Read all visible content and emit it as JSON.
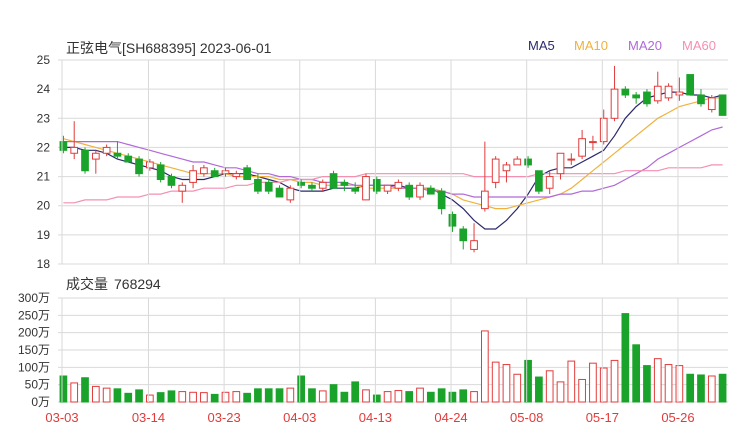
{
  "header": {
    "title": "正弦电气[SH688395] 2023-06-01"
  },
  "legend": [
    {
      "label": "MA5",
      "color": "#2a2a6e"
    },
    {
      "label": "MA10",
      "color": "#f0b23c"
    },
    {
      "label": "MA20",
      "color": "#b169d8"
    },
    {
      "label": "MA60",
      "color": "#f58fb0"
    }
  ],
  "volume": {
    "label": "成交量",
    "value": "768294"
  },
  "colors": {
    "up": "#e23b3b",
    "down": "#1aa32a",
    "grid": "#d9d9d9",
    "axis_text": "#e23b3b"
  },
  "chart_data": [
    {
      "type": "candlestick",
      "title": "正弦电气[SH688395] 2023-06-01",
      "ylim": [
        18,
        25
      ],
      "yticks": [
        "25",
        "24",
        "23",
        "22",
        "21",
        "20",
        "19",
        "18"
      ],
      "x_tick_labels": [
        "03-03",
        "03-14",
        "03-23",
        "04-03",
        "04-13",
        "04-24",
        "05-08",
        "05-17",
        "05-26"
      ],
      "x_tick_index": [
        0,
        8,
        15,
        22,
        29,
        36,
        43,
        50,
        57
      ],
      "ohlc": [
        [
          22.2,
          22.4,
          21.8,
          21.9
        ],
        [
          21.8,
          22.9,
          21.6,
          22.0
        ],
        [
          21.9,
          22.0,
          21.1,
          21.2
        ],
        [
          21.6,
          21.9,
          21.1,
          21.8
        ],
        [
          21.8,
          22.1,
          21.7,
          22.0
        ],
        [
          21.8,
          22.2,
          21.6,
          21.7
        ],
        [
          21.7,
          21.8,
          21.5,
          21.5
        ],
        [
          21.6,
          21.7,
          21.0,
          21.1
        ],
        [
          21.3,
          21.6,
          21.2,
          21.5
        ],
        [
          21.4,
          21.5,
          20.8,
          20.9
        ],
        [
          21.0,
          21.1,
          20.6,
          20.7
        ],
        [
          20.5,
          20.8,
          20.1,
          20.7
        ],
        [
          20.8,
          21.4,
          20.6,
          21.2
        ],
        [
          21.1,
          21.4,
          21.0,
          21.3
        ],
        [
          21.2,
          21.3,
          21.0,
          21.0
        ],
        [
          21.1,
          21.3,
          21.0,
          21.2
        ],
        [
          21.0,
          21.2,
          20.9,
          21.1
        ],
        [
          21.3,
          21.4,
          20.9,
          20.9
        ],
        [
          20.9,
          21.1,
          20.4,
          20.5
        ],
        [
          20.8,
          20.9,
          20.4,
          20.5
        ],
        [
          20.6,
          20.7,
          20.3,
          20.3
        ],
        [
          20.2,
          20.7,
          20.1,
          20.6
        ],
        [
          20.8,
          20.9,
          20.6,
          20.7
        ],
        [
          20.7,
          20.8,
          20.5,
          20.6
        ],
        [
          20.6,
          20.9,
          20.5,
          20.8
        ],
        [
          21.1,
          21.2,
          20.6,
          20.6
        ],
        [
          20.8,
          20.9,
          20.5,
          20.7
        ],
        [
          20.6,
          20.8,
          20.4,
          20.5
        ],
        [
          20.2,
          21.1,
          20.2,
          21.0
        ],
        [
          20.9,
          21.0,
          20.4,
          20.5
        ],
        [
          20.5,
          20.7,
          20.4,
          20.7
        ],
        [
          20.6,
          20.9,
          20.5,
          20.8
        ],
        [
          20.7,
          20.8,
          20.2,
          20.3
        ],
        [
          20.3,
          20.8,
          20.2,
          20.7
        ],
        [
          20.6,
          20.7,
          20.4,
          20.4
        ],
        [
          20.5,
          20.6,
          19.7,
          19.9
        ],
        [
          19.7,
          19.8,
          19.1,
          19.3
        ],
        [
          19.2,
          19.3,
          18.5,
          18.8
        ],
        [
          18.5,
          19.4,
          18.4,
          18.8
        ],
        [
          19.9,
          22.2,
          19.8,
          20.5
        ],
        [
          20.8,
          21.7,
          20.6,
          21.6
        ],
        [
          21.2,
          21.5,
          20.8,
          21.4
        ],
        [
          21.4,
          21.7,
          21.4,
          21.6
        ],
        [
          21.6,
          21.7,
          21.3,
          21.4
        ],
        [
          21.2,
          21.2,
          20.4,
          20.5
        ],
        [
          20.6,
          21.2,
          20.4,
          21.0
        ],
        [
          21.1,
          21.8,
          20.9,
          21.8
        ],
        [
          21.6,
          21.8,
          21.4,
          21.6
        ],
        [
          21.7,
          22.6,
          21.6,
          22.3
        ],
        [
          22.2,
          22.4,
          21.9,
          22.2
        ],
        [
          22.2,
          23.3,
          22.1,
          23.0
        ],
        [
          23.0,
          24.8,
          22.9,
          24.0
        ],
        [
          24.0,
          24.1,
          23.7,
          23.8
        ],
        [
          23.8,
          23.9,
          23.5,
          23.7
        ],
        [
          23.9,
          24.0,
          23.4,
          23.5
        ],
        [
          23.6,
          24.6,
          23.5,
          24.1
        ],
        [
          23.7,
          24.2,
          23.6,
          24.1
        ],
        [
          23.8,
          24.4,
          23.6,
          23.9
        ],
        [
          24.5,
          24.5,
          23.8,
          23.8
        ],
        [
          23.8,
          24.0,
          23.4,
          23.5
        ],
        [
          23.3,
          23.8,
          23.2,
          23.7
        ],
        [
          23.8,
          23.8,
          23.1,
          23.1
        ]
      ],
      "series": [
        {
          "name": "MA5",
          "values": [
            22.0,
            22.0,
            21.9,
            21.9,
            21.8,
            21.6,
            21.5,
            21.4,
            21.3,
            21.2,
            21.0,
            20.9,
            20.9,
            20.9,
            21.0,
            21.1,
            21.1,
            21.1,
            21.0,
            20.9,
            20.8,
            20.6,
            20.5,
            20.5,
            20.5,
            20.6,
            20.6,
            20.6,
            20.7,
            20.7,
            20.7,
            20.7,
            20.6,
            20.6,
            20.6,
            20.4,
            20.2,
            19.9,
            19.5,
            19.2,
            19.2,
            19.5,
            19.9,
            20.4,
            21.0,
            21.2,
            21.3,
            21.3,
            21.5,
            21.7,
            21.9,
            22.4,
            23.0,
            23.4,
            23.7,
            23.8,
            23.9,
            23.9,
            23.8,
            23.8,
            23.7,
            23.8
          ]
        },
        {
          "name": "MA10",
          "values": [
            22.3,
            22.2,
            22.1,
            22.0,
            21.9,
            21.8,
            21.7,
            21.6,
            21.5,
            21.4,
            21.3,
            21.2,
            21.1,
            21.1,
            21.1,
            21.1,
            21.0,
            21.0,
            21.0,
            21.0,
            20.9,
            20.9,
            20.8,
            20.8,
            20.7,
            20.7,
            20.7,
            20.7,
            20.6,
            20.6,
            20.6,
            20.6,
            20.6,
            20.6,
            20.6,
            20.5,
            20.4,
            20.2,
            20.1,
            20.0,
            19.9,
            19.9,
            20.0,
            20.1,
            20.2,
            20.3,
            20.4,
            20.6,
            20.9,
            21.2,
            21.5,
            21.8,
            22.1,
            22.4,
            22.7,
            23.0,
            23.2,
            23.4,
            23.5,
            23.6,
            23.7,
            23.7
          ]
        },
        {
          "name": "MA20",
          "values": [
            22.2,
            22.2,
            22.2,
            22.2,
            22.2,
            22.2,
            22.1,
            22.0,
            21.9,
            21.8,
            21.7,
            21.6,
            21.5,
            21.5,
            21.4,
            21.3,
            21.3,
            21.2,
            21.1,
            21.1,
            21.0,
            21.0,
            20.9,
            20.9,
            20.8,
            20.8,
            20.8,
            20.7,
            20.7,
            20.7,
            20.7,
            20.6,
            20.6,
            20.6,
            20.5,
            20.5,
            20.4,
            20.4,
            20.3,
            20.3,
            20.3,
            20.3,
            20.3,
            20.3,
            20.3,
            20.3,
            20.4,
            20.4,
            20.5,
            20.5,
            20.6,
            20.7,
            20.9,
            21.1,
            21.3,
            21.6,
            21.8,
            22.0,
            22.2,
            22.4,
            22.6,
            22.7
          ]
        },
        {
          "name": "MA60",
          "values": [
            20.1,
            20.1,
            20.2,
            20.2,
            20.2,
            20.3,
            20.3,
            20.3,
            20.4,
            20.4,
            20.5,
            20.5,
            20.5,
            20.6,
            20.6,
            20.6,
            20.7,
            20.7,
            20.8,
            20.8,
            20.8,
            20.9,
            20.9,
            20.9,
            21.0,
            21.0,
            21.0,
            21.0,
            21.1,
            21.1,
            21.1,
            21.1,
            21.1,
            21.1,
            21.1,
            21.1,
            21.1,
            21.1,
            21.0,
            21.0,
            21.0,
            21.0,
            21.0,
            21.0,
            21.1,
            21.1,
            21.1,
            21.1,
            21.1,
            21.1,
            21.1,
            21.1,
            21.2,
            21.2,
            21.2,
            21.2,
            21.3,
            21.3,
            21.3,
            21.3,
            21.4,
            21.4
          ]
        }
      ]
    },
    {
      "type": "bar",
      "title": "成交量 768294",
      "ylim": [
        0,
        300
      ],
      "yticks": [
        "300万",
        "250万",
        "200万",
        "150万",
        "100万",
        "50万",
        "0万"
      ],
      "unit": "万",
      "values": [
        75,
        55,
        70,
        45,
        40,
        38,
        25,
        35,
        20,
        27,
        32,
        30,
        28,
        27,
        22,
        28,
        30,
        25,
        38,
        38,
        38,
        40,
        75,
        38,
        32,
        50,
        28,
        58,
        35,
        20,
        30,
        33,
        30,
        40,
        28,
        38,
        28,
        35,
        30,
        205,
        115,
        108,
        80,
        120,
        72,
        90,
        58,
        118,
        65,
        112,
        98,
        120,
        255,
        165,
        105,
        125,
        108,
        105,
        80,
        78,
        75,
        80
      ]
    }
  ]
}
